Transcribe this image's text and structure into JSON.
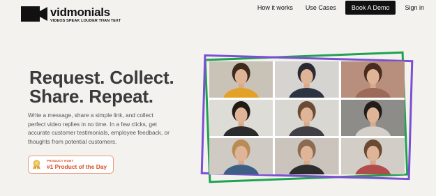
{
  "header": {
    "brand_name": "vidmonials",
    "brand_tagline": "VIDEOS SPEAK LOUDER THAN TEXT",
    "nav": [
      {
        "label": "How it works"
      },
      {
        "label": "Use Cases"
      },
      {
        "label": "Book A Demo"
      },
      {
        "label": "Sign in"
      }
    ]
  },
  "hero": {
    "headline_line1": "Request. Collect.",
    "headline_line2": "Share. Repeat.",
    "description": "Write a message, share a simple link, and collect perfect video replies in no time. In a few clicks, get accurate customer testimonials, employee feedback, or thoughts from potential customers.",
    "badge": {
      "label": "PRODUCT HUNT",
      "title": "#1 Product of the Day"
    }
  },
  "video_grid": {
    "tiles": [
      {
        "icon": "participant-video",
        "bg": "#c9c2b6",
        "shirt": "#e3a227",
        "hair": "#3b2a1d"
      },
      {
        "icon": "participant-video",
        "bg": "#d5d4d1",
        "shirt": "#2c3442",
        "hair": "#2a2a33"
      },
      {
        "icon": "participant-video",
        "bg": "#b88f7d",
        "shirt": "#9c6a57",
        "hair": "#4a2b1f"
      },
      {
        "icon": "participant-video",
        "bg": "#dedcd7",
        "shirt": "#2b2b2b",
        "hair": "#1f1a17"
      },
      {
        "icon": "participant-video",
        "bg": "#d9d7d1",
        "shirt": "#3f3f45",
        "hair": "#6a4b35"
      },
      {
        "icon": "participant-video",
        "bg": "#8d8c89",
        "shirt": "#d4cfc9",
        "hair": "#221d1a"
      },
      {
        "icon": "participant-video",
        "bg": "#cfcac3",
        "shirt": "#3d5f86",
        "hair": "#b98b55"
      },
      {
        "icon": "participant-video",
        "bg": "#cac4bc",
        "shirt": "#2d2d2d",
        "hair": "#8a6a50"
      },
      {
        "icon": "participant-video",
        "bg": "#d2cdc6",
        "shirt": "#b24b4b",
        "hair": "#6b4a33"
      }
    ]
  },
  "colors": {
    "accent_green": "#1fa24f",
    "accent_purple": "#7b4fd3",
    "badge_orange": "#d6502a"
  }
}
